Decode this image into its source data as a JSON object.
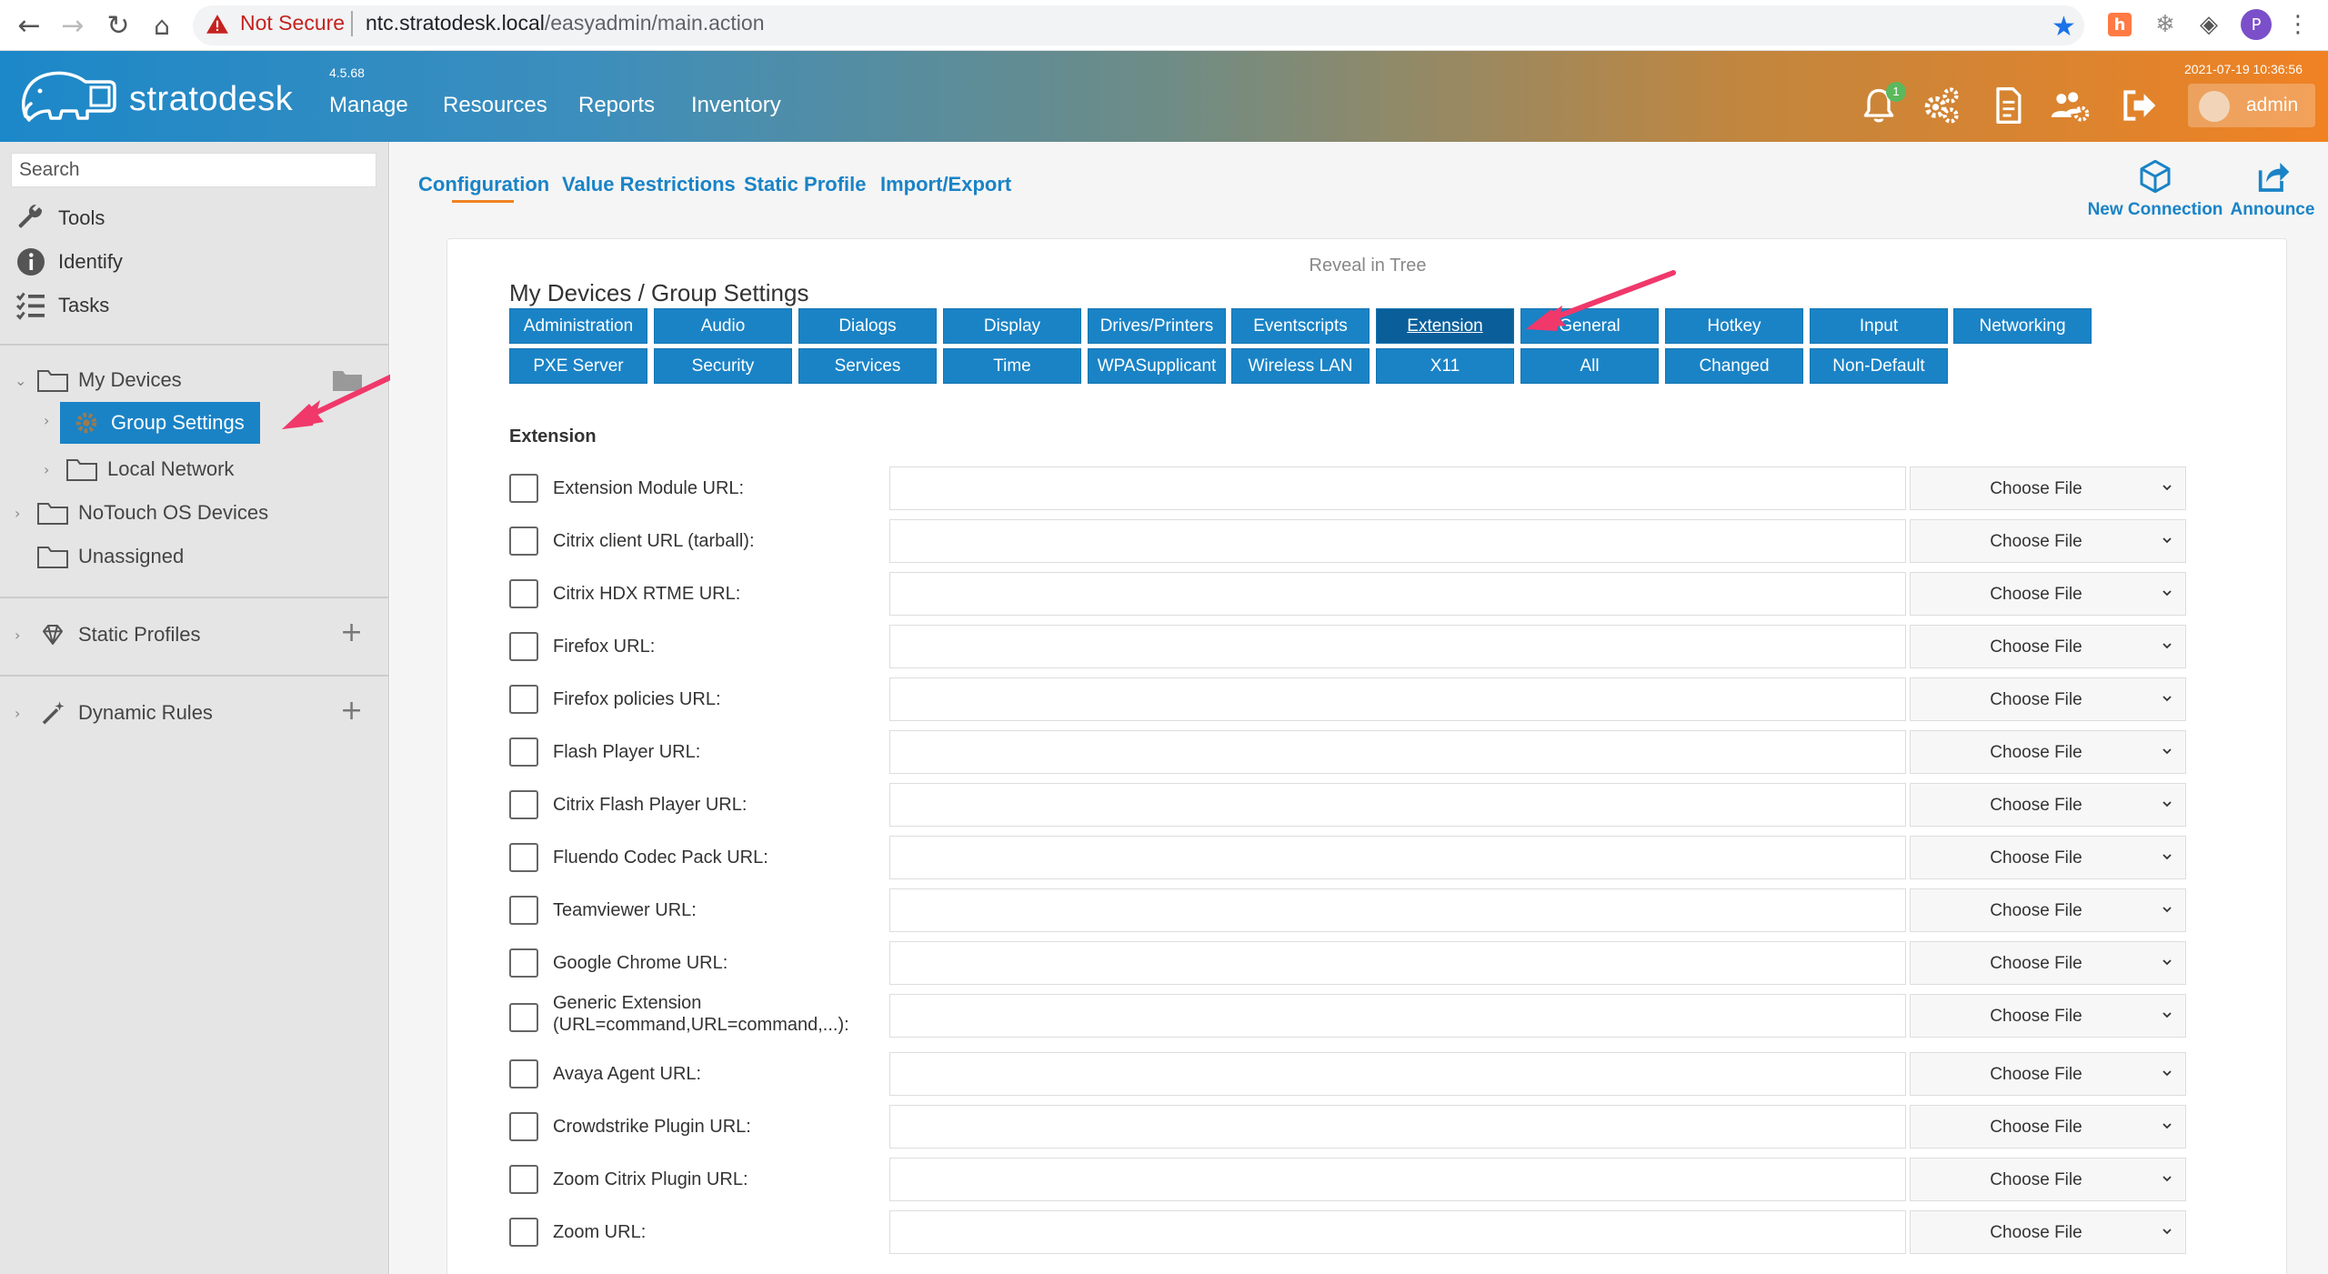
{
  "browser": {
    "security_label": "Not Secure",
    "url_host": "ntc.stratodesk.local",
    "url_path": "/easyadmin/main.action",
    "profile_initial": "P"
  },
  "header": {
    "logo_text": "stratodesk",
    "version": "4.5.68",
    "menu": [
      "Manage",
      "Resources",
      "Reports",
      "Inventory"
    ],
    "datetime": "2021-07-19 10:36:56",
    "notification_count": "1",
    "user": "admin"
  },
  "sidebar": {
    "search_placeholder": "Search",
    "tools": [
      {
        "label": "Tools",
        "icon": "wrench-icon"
      },
      {
        "label": "Identify",
        "icon": "info-icon"
      },
      {
        "label": "Tasks",
        "icon": "checklist-icon"
      }
    ],
    "tree": {
      "my_devices": "My Devices",
      "group_settings": "Group Settings",
      "local_network": "Local Network",
      "notouch": "NoTouch OS Devices",
      "unassigned": "Unassigned"
    },
    "static_profiles": "Static Profiles",
    "dynamic_rules": "Dynamic Rules"
  },
  "main": {
    "subtabs": [
      "Configuration",
      "Value Restrictions",
      "Static Profile",
      "Import/Export"
    ],
    "actions": {
      "new_connection": "New Connection",
      "announce": "Announce"
    },
    "reveal": "Reveal in Tree",
    "breadcrumb": "My Devices / Group Settings",
    "categories_row1": [
      "Administration",
      "Audio",
      "Dialogs",
      "Display",
      "Drives/Printers",
      "Eventscripts",
      "Extension",
      "General",
      "Hotkey",
      "Input",
      "Networking"
    ],
    "categories_row2": [
      "PXE Server",
      "Security",
      "Services",
      "Time",
      "WPASupplicant",
      "Wireless LAN",
      "X11",
      "All",
      "Changed",
      "Non-Default"
    ],
    "active_category": "Extension",
    "section_title": "Extension",
    "choose_label": "Choose File",
    "fields": [
      "Extension Module URL:",
      "Citrix client URL (tarball):",
      "Citrix HDX RTME URL:",
      "Firefox URL:",
      "Firefox policies URL:",
      "Flash Player URL:",
      "Citrix Flash Player URL:",
      "Fluendo Codec Pack URL:",
      "Teamviewer URL:",
      "Google Chrome URL:",
      "Generic Extension (URL=command,URL=command,...):",
      "Avaya Agent URL:",
      "Crowdstrike Plugin URL:",
      "Zoom Citrix Plugin URL:",
      "Zoom URL:"
    ]
  },
  "colors": {
    "accent": "#1a83c6",
    "header_start": "#1c88c9",
    "header_end": "#f08223",
    "annotation_arrow": "#f0386b"
  }
}
